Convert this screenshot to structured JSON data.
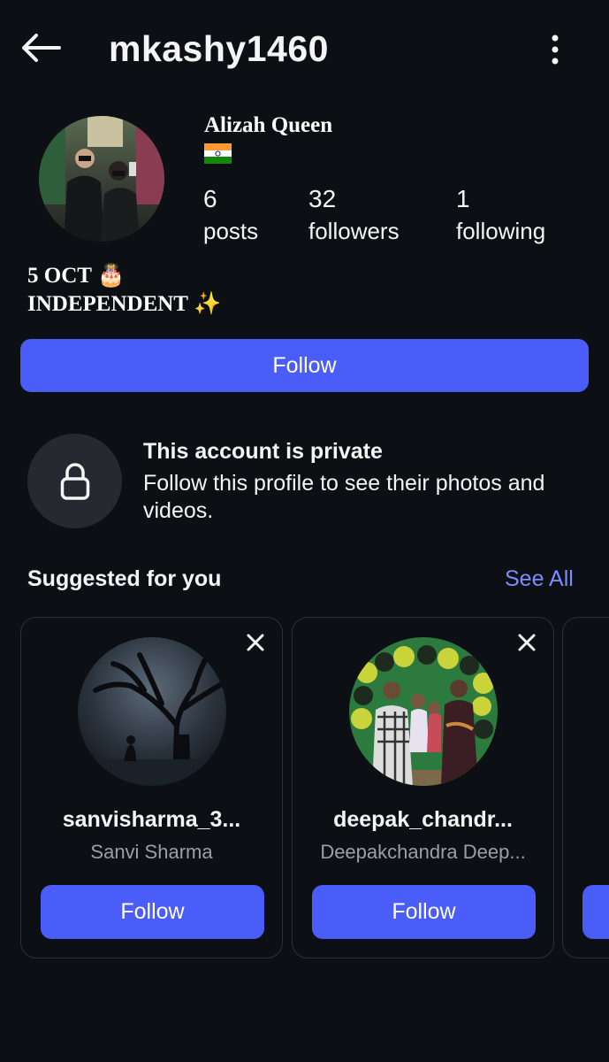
{
  "header": {
    "username": "mkashy1460",
    "back_icon": "arrow-left-icon",
    "more_icon": "more-vertical-icon"
  },
  "profile": {
    "display_name": "Alizah Queen",
    "flag": "india-flag",
    "stats": [
      {
        "value": "6",
        "label": "posts"
      },
      {
        "value": "32",
        "label": "followers"
      },
      {
        "value": "1",
        "label": "following"
      }
    ],
    "bio_line1": "5 OCT",
    "bio_line1_emoji": "🎂",
    "bio_line2": "INDEPENDENT",
    "bio_line2_emoji": "✨"
  },
  "actions": {
    "follow_label": "Follow"
  },
  "private_notice": {
    "icon": "lock-icon",
    "title": "This account is private",
    "description": "Follow this profile to see their photos and videos."
  },
  "suggestions": {
    "title": "Suggested for you",
    "see_all": "See All",
    "cards": [
      {
        "username": "sanvisharma_3...",
        "name": "Sanvi Sharma",
        "follow_label": "Follow"
      },
      {
        "username": "deepak_chandr...",
        "name": "Deepakchandra Deep...",
        "follow_label": "Follow"
      }
    ]
  },
  "colors": {
    "background": "#0c1014",
    "accent": "#4a5df9",
    "link": "#7c8bff",
    "muted_text": "#9aa0a6"
  }
}
